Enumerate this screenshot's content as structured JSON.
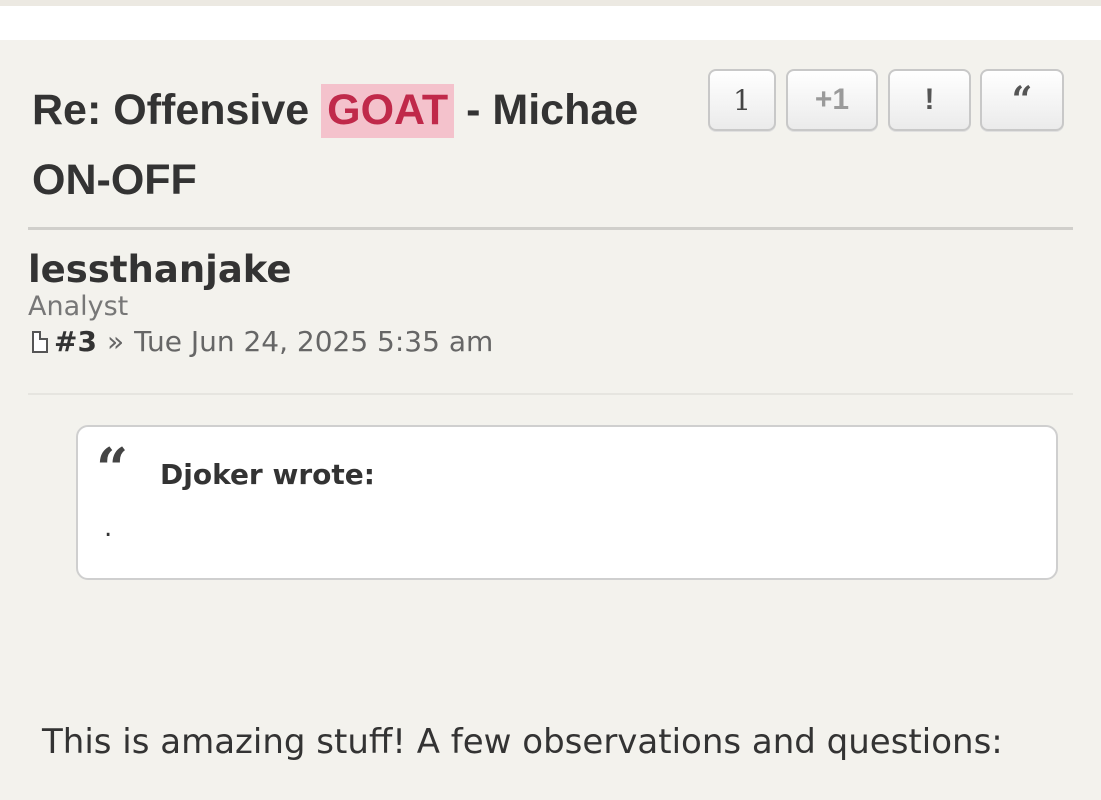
{
  "post": {
    "title_prefix": "Re: Offensive",
    "title_highlight": "GOAT",
    "title_suffix": "- Michae",
    "title_line2": "ON-OFF",
    "actions": {
      "like_count": "1",
      "plus_one": "+1",
      "report": "!",
      "quote": "“"
    },
    "author": "lessthanjake",
    "rank": "Analyst",
    "post_number": "#3",
    "separator": "»",
    "timestamp": "Tue Jun 24, 2025 5:35 am",
    "quote": {
      "mark": "“",
      "author_line": "Djoker wrote:",
      "body": "."
    },
    "body_text": "This is amazing stuff! A few observations and questions:"
  },
  "colors": {
    "page_bg": "#f3f2ed",
    "highlight_bg": "#f4c2cc",
    "highlight_text": "#c0294a",
    "text": "#333333"
  }
}
